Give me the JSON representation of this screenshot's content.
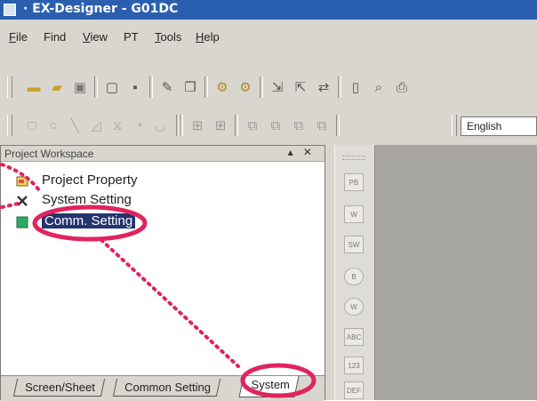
{
  "window": {
    "title": "· EX-Designer - G01DC"
  },
  "menu": {
    "items": [
      {
        "first": "F",
        "rest": "ile"
      },
      {
        "first": "",
        "rest": "Find"
      },
      {
        "first": "V",
        "rest": "iew"
      },
      {
        "first": "",
        "rest": "PT"
      },
      {
        "first": "T",
        "rest": "ools"
      },
      {
        "first": "H",
        "rest": "elp"
      }
    ]
  },
  "toolbar": {
    "language": "English",
    "icons": [
      "new-folder-icon",
      "open-folder-icon",
      "save-all-icon",
      "new-document-icon",
      "save-icon",
      "edit-icon",
      "copy-icon",
      "compile-icon",
      "compile-all-icon",
      "import-icon",
      "export-icon",
      "transfer-icon",
      "document-icon",
      "print-preview-icon",
      "print-icon"
    ],
    "shape_icons": [
      "rectangle-icon",
      "ellipse-icon",
      "line-icon",
      "polygon-icon",
      "hourglass-icon",
      "arc-icon",
      "pie-icon",
      "align-left-icon",
      "align-right-icon",
      "bring-front-icon",
      "send-back-icon",
      "group-icon",
      "ungroup-icon"
    ]
  },
  "workspace": {
    "title": "Project Workspace",
    "close_glyphs": "▴ ✕",
    "tree": [
      {
        "label": "Project Property",
        "icon": "project-property-icon"
      },
      {
        "label": "System Setting",
        "icon": "system-setting-icon"
      },
      {
        "label": "Comm. Setting",
        "icon": "comm-setting-icon",
        "selected": true
      }
    ],
    "tabs": [
      {
        "label": "Screen/Sheet",
        "active": false
      },
      {
        "label": "Common Setting",
        "active": false
      },
      {
        "label": "System",
        "active": true
      }
    ]
  },
  "vertical_toolbar": {
    "buttons": [
      {
        "label": "PB",
        "shape": "square"
      },
      {
        "label": "W",
        "shape": "square"
      },
      {
        "label": "SW",
        "shape": "square"
      },
      {
        "label": "B",
        "shape": "circle"
      },
      {
        "label": "W",
        "shape": "circle"
      },
      {
        "label": "ABC",
        "shape": "square"
      },
      {
        "label": "123",
        "shape": "square"
      },
      {
        "label": "DEF",
        "shape": "square"
      }
    ]
  },
  "annotation": {
    "color": "#e0245e"
  }
}
